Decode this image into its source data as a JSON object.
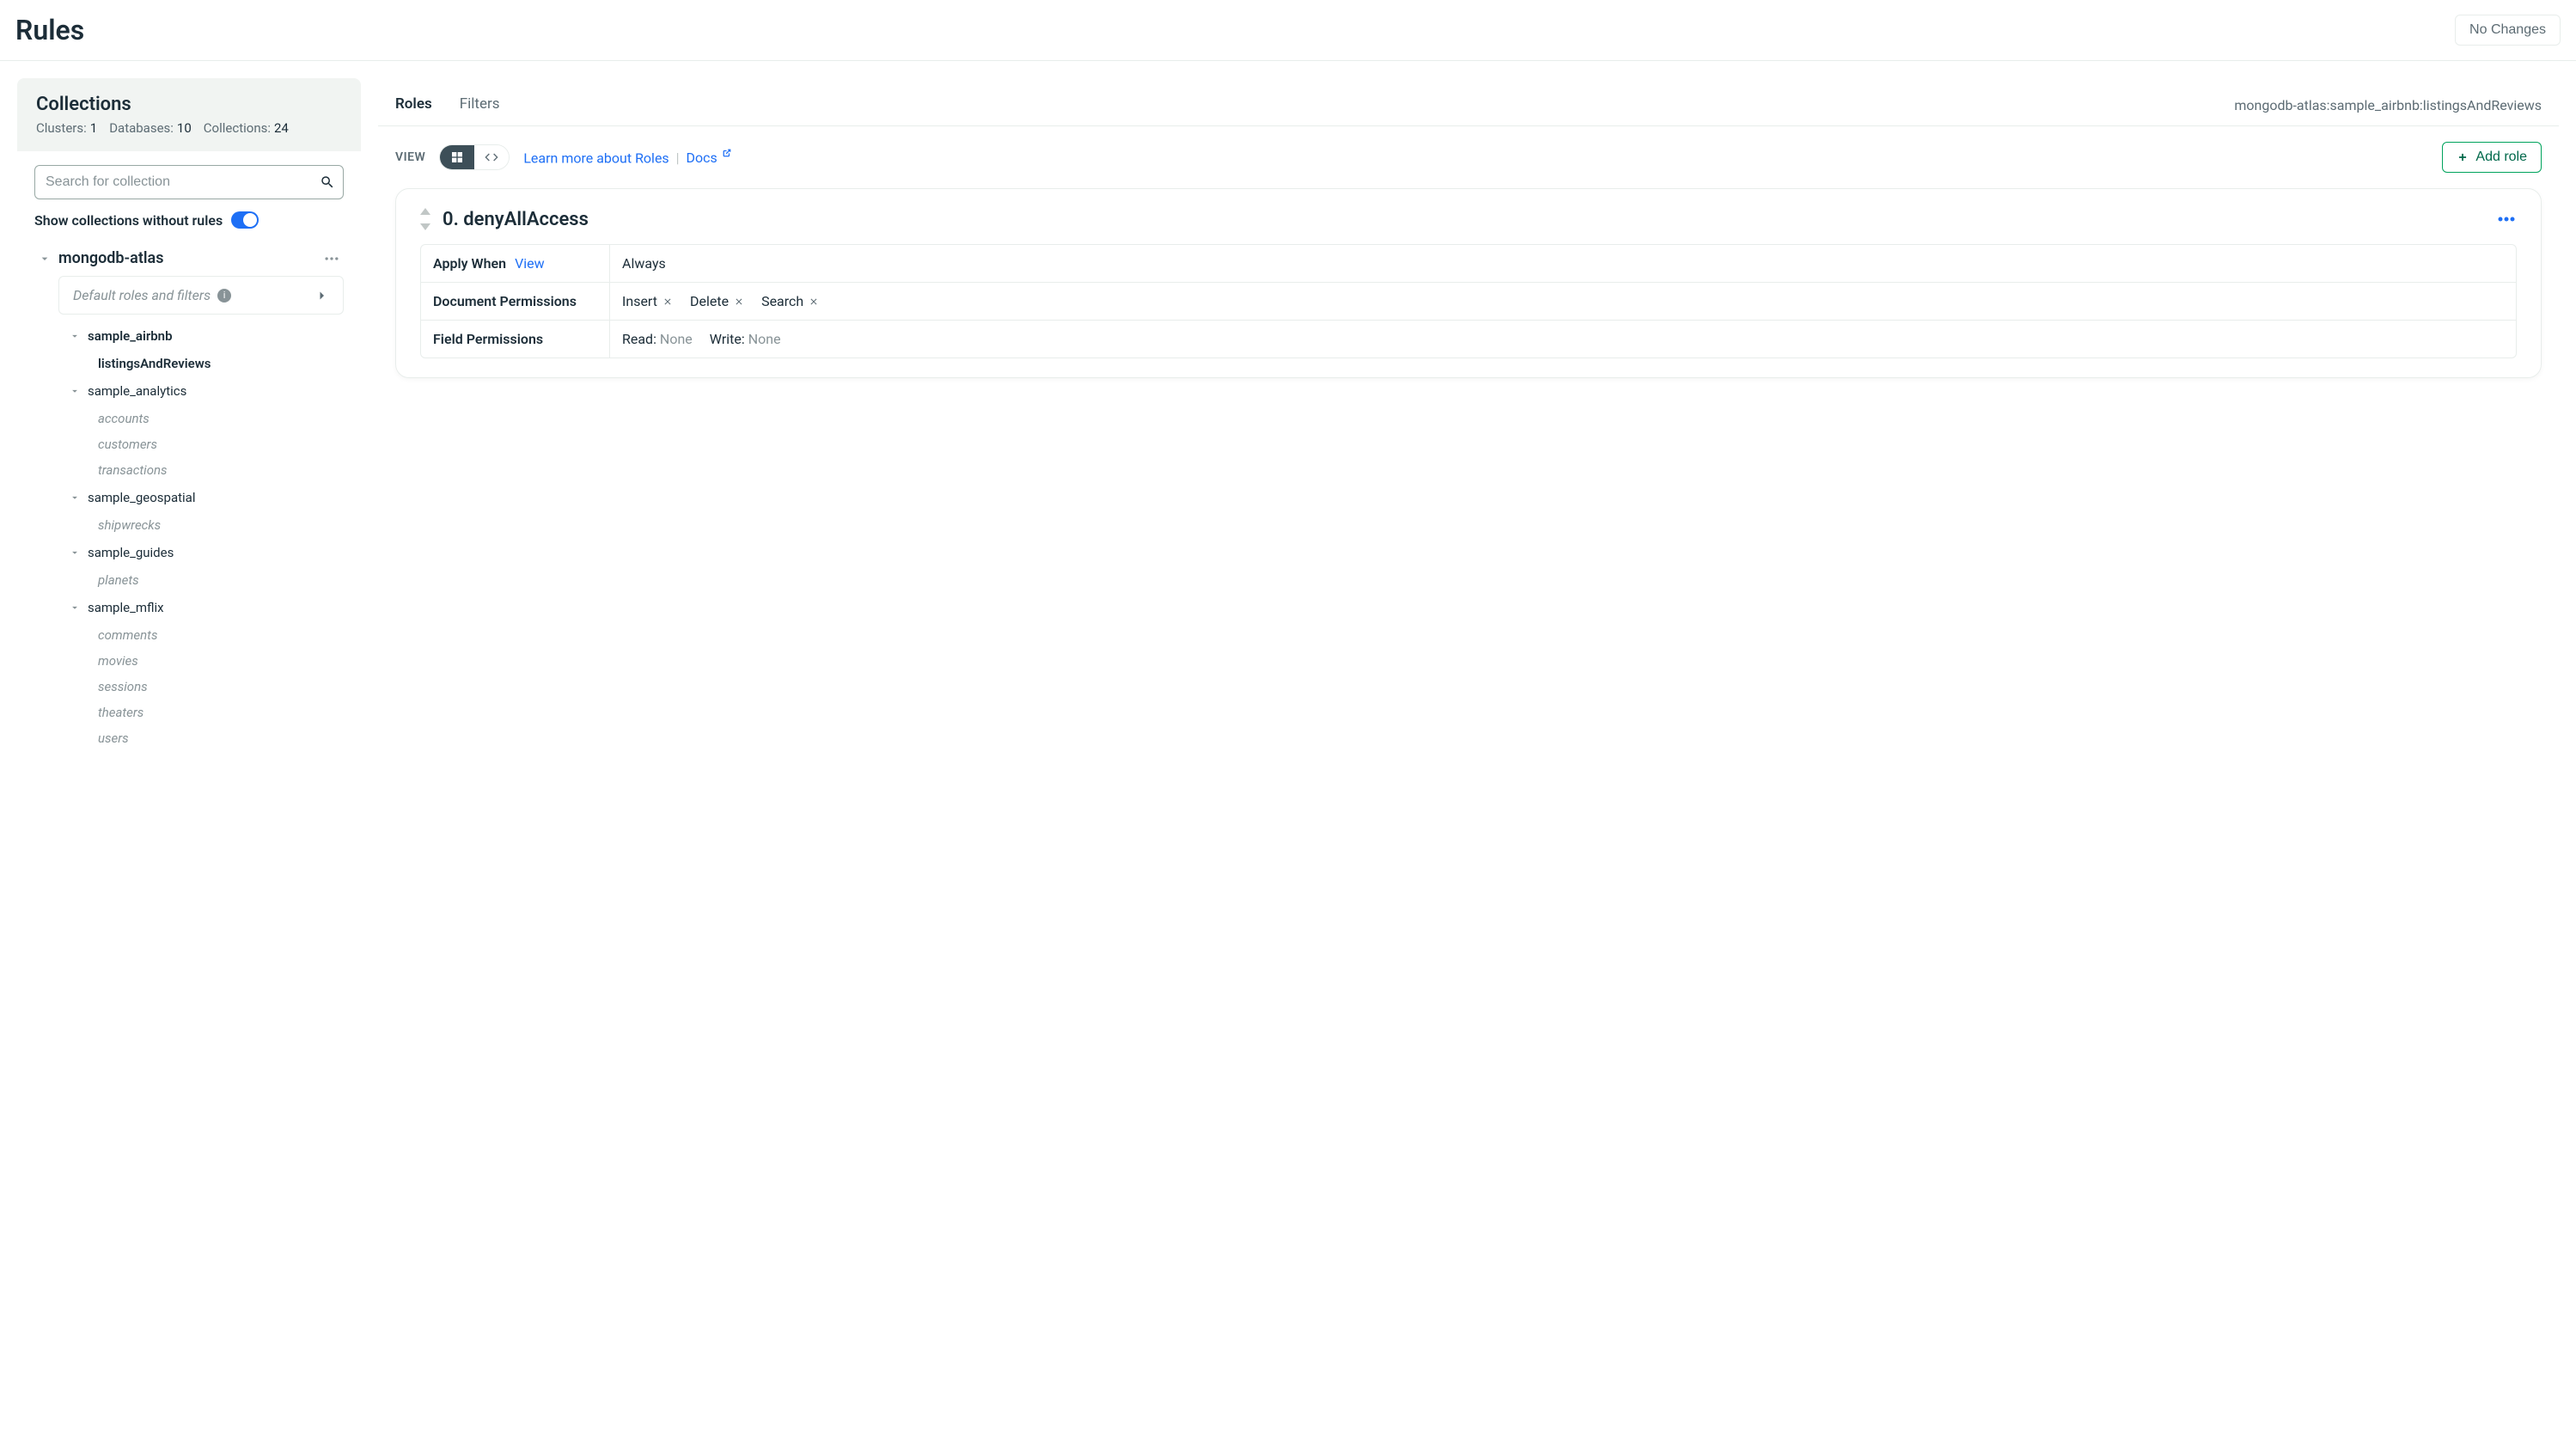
{
  "header": {
    "title": "Rules",
    "no_changes_label": "No Changes"
  },
  "sidebar": {
    "collections_title": "Collections",
    "stats": {
      "clusters_label": "Clusters:",
      "clusters_value": "1",
      "databases_label": "Databases:",
      "databases_value": "10",
      "collections_label": "Collections:",
      "collections_value": "24"
    },
    "search_placeholder": "Search for collection",
    "toggle_label": "Show collections without rules",
    "datasource_name": "mongodb-atlas",
    "default_roles_label": "Default roles and filters",
    "databases": [
      {
        "name": "sample_airbnb",
        "active": true,
        "collections": [
          {
            "name": "listingsAndReviews",
            "active": true
          }
        ]
      },
      {
        "name": "sample_analytics",
        "active": false,
        "collections": [
          {
            "name": "accounts"
          },
          {
            "name": "customers"
          },
          {
            "name": "transactions"
          }
        ]
      },
      {
        "name": "sample_geospatial",
        "active": false,
        "collections": [
          {
            "name": "shipwrecks"
          }
        ]
      },
      {
        "name": "sample_guides",
        "active": false,
        "collections": [
          {
            "name": "planets"
          }
        ]
      },
      {
        "name": "sample_mflix",
        "active": false,
        "collections": [
          {
            "name": "comments"
          },
          {
            "name": "movies"
          },
          {
            "name": "sessions"
          },
          {
            "name": "theaters"
          },
          {
            "name": "users"
          }
        ]
      }
    ]
  },
  "content": {
    "tabs": {
      "roles": "Roles",
      "filters": "Filters"
    },
    "breadcrumb": "mongodb-atlas:sample_airbnb:listingsAndReviews",
    "toolbar": {
      "view_label": "VIEW",
      "learn_more": "Learn more about Roles",
      "docs_label": "Docs",
      "add_role_label": "Add role"
    },
    "role": {
      "name": "0. denyAllAccess",
      "rows": {
        "apply_when": {
          "label": "Apply When",
          "view": "View",
          "value": "Always"
        },
        "doc_perms": {
          "label": "Document Permissions",
          "items": [
            "Insert",
            "Delete",
            "Search"
          ]
        },
        "field_perms": {
          "label": "Field Permissions",
          "read_label": "Read:",
          "read_value": "None",
          "write_label": "Write:",
          "write_value": "None"
        }
      }
    }
  }
}
